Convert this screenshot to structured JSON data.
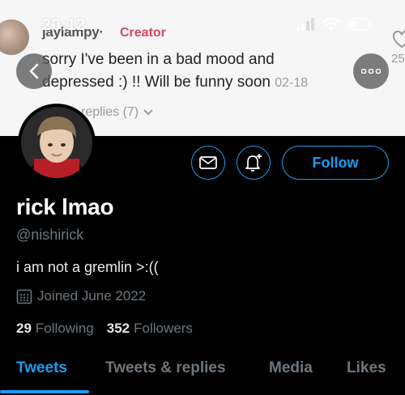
{
  "status_bar": {
    "time": "20:12"
  },
  "banner": {
    "commenter": "jaylampy·",
    "badge": "Creator",
    "comment": "sorry I've been in a bad mood and depressed :) !! Will be funny soon",
    "date": "02-18",
    "replies": "replies (7)",
    "like_count": "25"
  },
  "profile": {
    "display_name": "rick lmao",
    "handle": "@nishirick",
    "bio": "i am not a gremlin >:((",
    "joined": "Joined June 2022",
    "following_count": "29",
    "following_label": "Following",
    "followers_count": "352",
    "followers_label": "Followers"
  },
  "actions": {
    "follow_label": "Follow"
  },
  "tabs": [
    {
      "label": "Tweets",
      "active": true
    },
    {
      "label": "Tweets & replies",
      "active": false
    },
    {
      "label": "Media",
      "active": false
    },
    {
      "label": "Likes",
      "active": false
    }
  ],
  "colors": {
    "accent": "#1d9bf0",
    "background": "#000000",
    "secondary_text": "#6e767d",
    "creator_badge": "#d6455f"
  }
}
